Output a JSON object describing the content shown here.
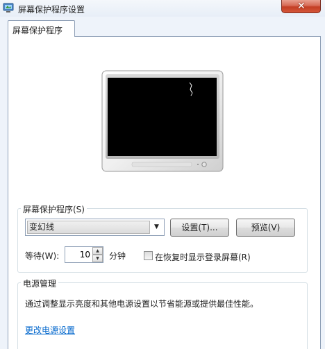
{
  "window": {
    "title": "屏幕保护程序设置",
    "icon": "screen-saver-settings-icon",
    "close_glyph": "✕"
  },
  "tabs": [
    {
      "label": "屏幕保护程序"
    }
  ],
  "screensaver_group": {
    "label": "屏幕保护程序(S)",
    "selected": "变幻线",
    "settings_button": "设置(T)...",
    "preview_button": "预览(V)",
    "wait_label": "等待(W):",
    "wait_value": "10",
    "wait_unit": "分钟",
    "logon_checkbox_label": "在恢复时显示登录屏幕(R)",
    "logon_checked": false
  },
  "power_group": {
    "label": "电源管理",
    "description": "通过调整显示亮度和其他电源设置以节省能源或提供最佳性能。",
    "link": "更改电源设置"
  },
  "colors": {
    "close_button": "#c33f24",
    "link": "#0066cc",
    "panel_border": "#8e9fb6"
  }
}
